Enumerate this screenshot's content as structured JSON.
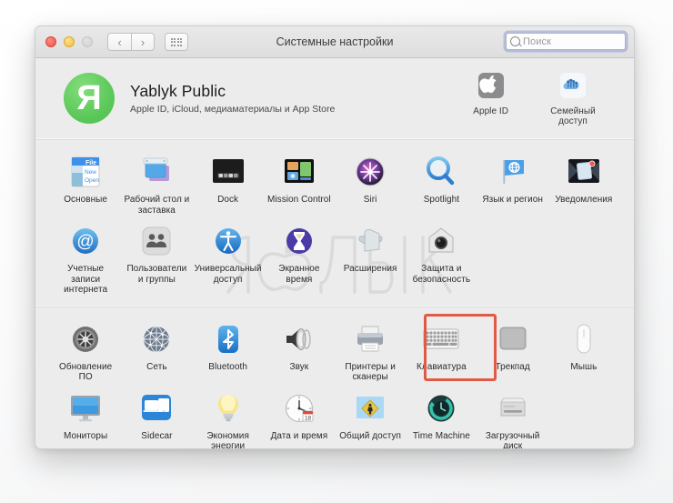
{
  "window": {
    "title": "Системные настройки",
    "traffic_lights": [
      "close",
      "minimize",
      "zoom"
    ],
    "nav_back": "‹",
    "nav_forward": "›",
    "grid_button": "show-all-icon"
  },
  "search": {
    "placeholder": "Поиск",
    "value": "",
    "icon": "search-icon",
    "focused": true,
    "focus_ring_color": "#8ca0d7"
  },
  "account": {
    "avatar_letter": "Я",
    "avatar_color": "#5cc95a",
    "name": "Yablyk Public",
    "subtitle": "Apple ID, iCloud, медиаматериалы и App Store",
    "items": [
      {
        "label": "Apple ID",
        "icon": "apple-id-icon"
      },
      {
        "label": "Семейный доступ",
        "icon": "family-sharing-icon"
      }
    ]
  },
  "watermark": {
    "text": "ЯБЛЫК",
    "has_apple_mark": true
  },
  "highlight": {
    "target": "Клавиатура",
    "color": "#e05b45"
  },
  "sections": [
    {
      "name": "personal",
      "rows": [
        [
          {
            "label": "Основные",
            "icon": "general-icon"
          },
          {
            "label": "Рабочий стол и заставка",
            "icon": "desktop-screensaver-icon"
          },
          {
            "label": "Dock",
            "icon": "dock-icon"
          },
          {
            "label": "Mission Control",
            "icon": "mission-control-icon"
          },
          {
            "label": "Siri",
            "icon": "siri-icon"
          },
          {
            "label": "Spotlight",
            "icon": "spotlight-icon"
          },
          {
            "label": "Язык и регион",
            "icon": "language-region-icon"
          },
          {
            "label": "Уведомления",
            "icon": "notifications-icon"
          }
        ],
        [
          {
            "label": "Учетные записи интернета",
            "icon": "internet-accounts-icon"
          },
          {
            "label": "Пользователи и группы",
            "icon": "users-groups-icon"
          },
          {
            "label": "Универсальный доступ",
            "icon": "accessibility-icon"
          },
          {
            "label": "Экранное время",
            "icon": "screen-time-icon"
          },
          {
            "label": "Расширения",
            "icon": "extensions-icon"
          },
          {
            "label": "Защита и безопасность",
            "icon": "security-privacy-icon"
          }
        ]
      ]
    },
    {
      "name": "hardware",
      "rows": [
        [
          {
            "label": "Обновление ПО",
            "icon": "software-update-icon"
          },
          {
            "label": "Сеть",
            "icon": "network-icon"
          },
          {
            "label": "Bluetooth",
            "icon": "bluetooth-icon"
          },
          {
            "label": "Звук",
            "icon": "sound-icon"
          },
          {
            "label": "Принтеры и сканеры",
            "icon": "printers-scanners-icon"
          },
          {
            "label": "Клавиатура",
            "icon": "keyboard-icon"
          },
          {
            "label": "Трекпад",
            "icon": "trackpad-icon"
          },
          {
            "label": "Мышь",
            "icon": "mouse-icon"
          }
        ],
        [
          {
            "label": "Мониторы",
            "icon": "displays-icon"
          },
          {
            "label": "Sidecar",
            "icon": "sidecar-icon"
          },
          {
            "label": "Экономия энергии",
            "icon": "energy-saver-icon"
          },
          {
            "label": "Дата и время",
            "icon": "date-time-icon"
          },
          {
            "label": "Общий доступ",
            "icon": "sharing-icon"
          },
          {
            "label": "Time Machine",
            "icon": "time-machine-icon"
          },
          {
            "label": "Загрузочный диск",
            "icon": "startup-disk-icon"
          }
        ]
      ]
    }
  ]
}
